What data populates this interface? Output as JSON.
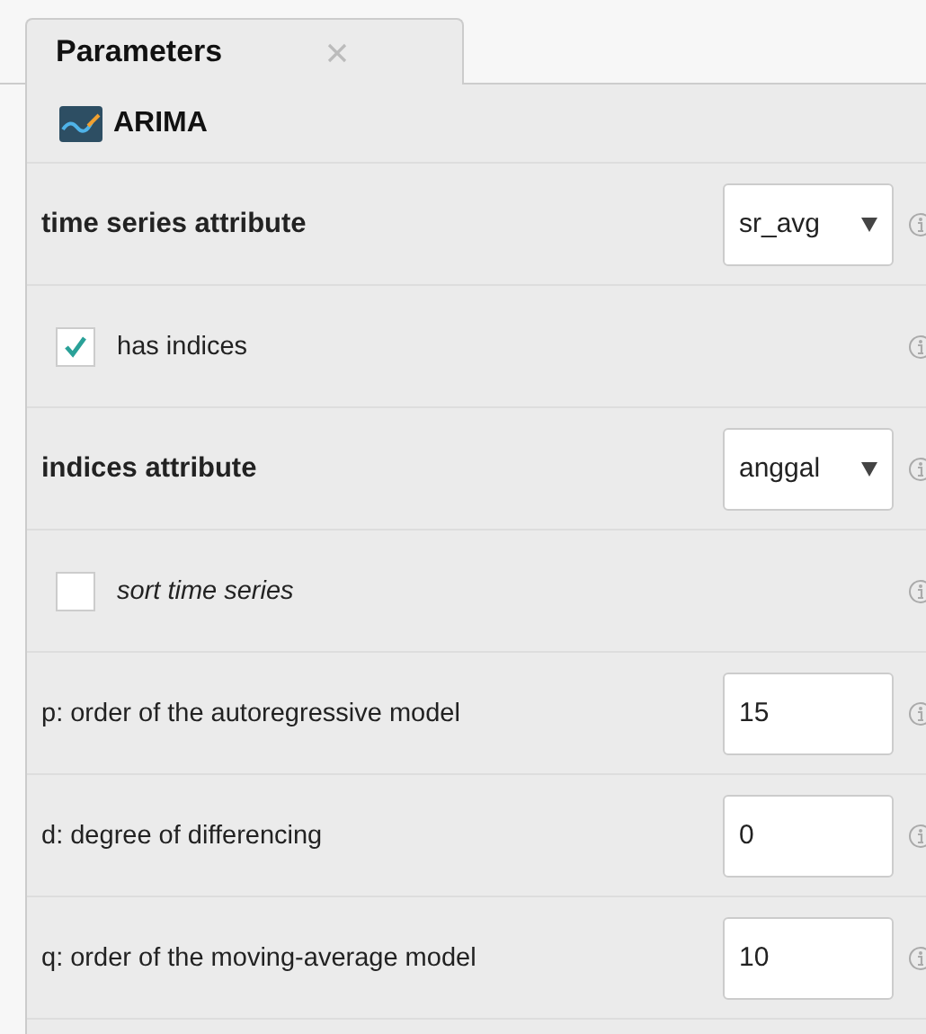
{
  "tabs": [
    {
      "label": "Parameters",
      "selected": true
    }
  ],
  "operator": {
    "name": "ARIMA"
  },
  "parameters": [
    {
      "kind": "select",
      "label": "time series attribute",
      "mandatory": true,
      "optional": false,
      "value": "sr_avg"
    },
    {
      "kind": "checkbox",
      "label": "has indices",
      "mandatory": false,
      "optional": false,
      "checked": true
    },
    {
      "kind": "select",
      "label": "indices attribute",
      "mandatory": true,
      "optional": false,
      "value": "anggal"
    },
    {
      "kind": "checkbox",
      "label": "sort time series",
      "mandatory": false,
      "optional": true,
      "checked": false
    },
    {
      "kind": "number",
      "label": "p: order of the autoregressive model",
      "mandatory": false,
      "optional": false,
      "value": "15"
    },
    {
      "kind": "number",
      "label": "d: degree of differencing",
      "mandatory": false,
      "optional": false,
      "value": "0"
    },
    {
      "kind": "number",
      "label": "q: order of the moving-average model",
      "mandatory": false,
      "optional": false,
      "value": "10"
    }
  ]
}
